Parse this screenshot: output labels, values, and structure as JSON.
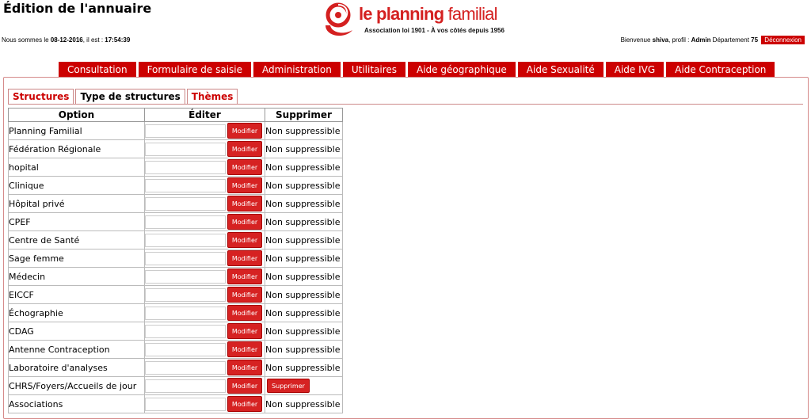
{
  "header": {
    "title": "Édition de l'annuaire",
    "date_prefix": "Nous sommes le ",
    "date": "08-12-2016",
    "time_prefix": ", il est : ",
    "time": "17:54:39",
    "logo_name_bold": "le planning",
    "logo_name_regular": " familial",
    "logo_tagline": "Association loi 1901 - À vos côtés depuis 1956",
    "welcome_prefix": "Bienvenue ",
    "user": "shiva",
    "profile_prefix": ", profil : ",
    "profile": "Admin",
    "department_prefix": " Département ",
    "department": "75",
    "logout_label": "Déconnexion",
    "accent_color": "#cc0000"
  },
  "nav": [
    {
      "label": "Consultation"
    },
    {
      "label": "Formulaire de saisie"
    },
    {
      "label": "Administration"
    },
    {
      "label": "Utilitaires"
    },
    {
      "label": "Aide géographique"
    },
    {
      "label": "Aide Sexualité"
    },
    {
      "label": "Aide IVG"
    },
    {
      "label": "Aide Contraception"
    }
  ],
  "tabs": [
    {
      "label": "Structures",
      "active": false
    },
    {
      "label": "Type de structures",
      "active": true
    },
    {
      "label": "Thèmes",
      "active": false
    }
  ],
  "table": {
    "headers": {
      "option": "Option",
      "edit": "Éditer",
      "delete": "Supprimer"
    },
    "modify_label": "Modifier",
    "delete_label": "Supprimer",
    "not_deletable_label": "Non suppressible",
    "rows": [
      {
        "option": "Planning Familial",
        "deletable": false
      },
      {
        "option": "Fédération Régionale",
        "deletable": false
      },
      {
        "option": "hopital",
        "deletable": false
      },
      {
        "option": "Clinique",
        "deletable": false
      },
      {
        "option": "Hôpital privé",
        "deletable": false
      },
      {
        "option": "CPEF",
        "deletable": false
      },
      {
        "option": "Centre de Santé",
        "deletable": false
      },
      {
        "option": "Sage femme",
        "deletable": false
      },
      {
        "option": "Médecin",
        "deletable": false
      },
      {
        "option": "EICCF",
        "deletable": false
      },
      {
        "option": "Échographie",
        "deletable": false
      },
      {
        "option": "CDAG",
        "deletable": false
      },
      {
        "option": "Antenne Contraception",
        "deletable": false
      },
      {
        "option": "Laboratoire d'analyses",
        "deletable": false
      },
      {
        "option": "CHRS/Foyers/Accueils de jour",
        "deletable": true
      },
      {
        "option": "Associations",
        "deletable": false
      }
    ]
  }
}
